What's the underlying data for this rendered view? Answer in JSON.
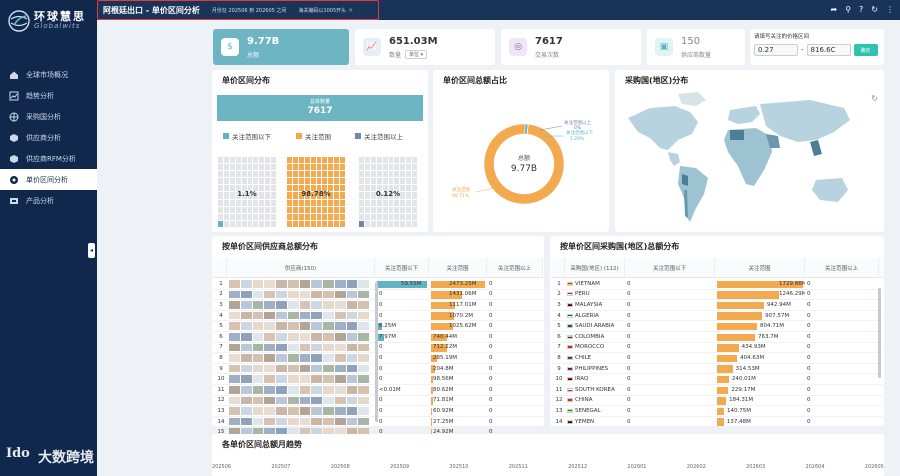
{
  "sidebar": {
    "logo_cn": "环球慧思",
    "logo_en": "Globalwits",
    "items": [
      {
        "label": "全球市场概况",
        "icon": "home-icon",
        "active": false
      },
      {
        "label": "趋势分析",
        "icon": "trend-icon",
        "active": false
      },
      {
        "label": "采购国分析",
        "icon": "globe-icon",
        "active": false
      },
      {
        "label": "供应商分析",
        "icon": "box-icon",
        "active": false
      },
      {
        "label": "供应商RFM分析",
        "icon": "box-icon",
        "active": false
      },
      {
        "label": "单价区间分析",
        "icon": "price-icon",
        "active": true
      },
      {
        "label": "产品分析",
        "icon": "product-icon",
        "active": false
      }
    ]
  },
  "watermark": {
    "mark": "Ido",
    "text": "大数跨境"
  },
  "topbar": {
    "tab_main": "阿根廷出口 - 单价区间分析",
    "tab_period": "月份在 202506 到 202605 之间",
    "tab_hs": "海关编码以1005开头",
    "close": "×"
  },
  "kpis": [
    {
      "value": "9.77B",
      "label": "总额",
      "icon": "dollar-icon"
    },
    {
      "value": "651.03M",
      "label": "数量",
      "unit": "单位",
      "icon": "chart-icon"
    },
    {
      "value": "7617",
      "label": "交易次数",
      "icon": "target-icon"
    },
    {
      "value": "150",
      "label": "供应商数量",
      "icon": "cube-icon"
    }
  ],
  "range": {
    "title": "请填写关注的价格区间",
    "min": "0.27",
    "sep": "-",
    "max": "816.6C",
    "button": "确定"
  },
  "dist": {
    "title": "单价区间分布",
    "total_label": "总体数量",
    "total_value": "7617",
    "legend": [
      "关注范围以下",
      "关注范围",
      "关注范围以上"
    ],
    "percents": [
      "1.1%",
      "98.78%",
      "0.12%"
    ],
    "fractions": [
      0.011,
      0.9878,
      0.0012
    ],
    "colors": [
      "#5fb3c4",
      "#f3aa4e",
      "#6f86a8"
    ]
  },
  "share": {
    "title": "单价区间总额占比",
    "center_label": "总额",
    "center_value": "9.77B",
    "slices": [
      {
        "label": "关注范围以上",
        "pct": "0%",
        "value": 0.0,
        "color": "#6f86a8"
      },
      {
        "label": "关注范围以下",
        "pct": "1.29%",
        "value": 1.29,
        "color": "#5fb3c4"
      },
      {
        "label": "关注范围",
        "pct": "98.71%",
        "value": 98.71,
        "color": "#f3aa4e"
      }
    ]
  },
  "map": {
    "title": "采购国(地区)分布"
  },
  "supplier_table": {
    "title": "按单价区间供应商总额分布",
    "headers": [
      "供应商(150)",
      "关注范围以下",
      "关注范围",
      "关注范围以上"
    ],
    "max_mid": 2473.25,
    "max_below": 59.55,
    "rows": [
      {
        "n": "1",
        "below": "59.55M",
        "below_v": 59.55,
        "mid": "2473.25M",
        "mid_v": 2473.25,
        "above": "0"
      },
      {
        "n": "2",
        "below": "0",
        "below_v": 0,
        "mid": "1431.06M",
        "mid_v": 1431.06,
        "above": "0"
      },
      {
        "n": "3",
        "below": "0",
        "below_v": 0,
        "mid": "1117.01M",
        "mid_v": 1117.01,
        "above": "0"
      },
      {
        "n": "4",
        "below": "0",
        "below_v": 0,
        "mid": "1070.2M",
        "mid_v": 1070.2,
        "above": "0"
      },
      {
        "n": "5",
        "below": "6.25M",
        "below_v": 6.25,
        "mid": "1025.62M",
        "mid_v": 1025.62,
        "above": "0"
      },
      {
        "n": "6",
        "below": "7.97M",
        "below_v": 7.97,
        "mid": "740.44M",
        "mid_v": 740.44,
        "above": "0"
      },
      {
        "n": "7",
        "below": "0",
        "below_v": 0,
        "mid": "712.22M",
        "mid_v": 712.22,
        "above": "0"
      },
      {
        "n": "8",
        "below": "0",
        "below_v": 0,
        "mid": "285.19M",
        "mid_v": 285.19,
        "above": "0"
      },
      {
        "n": "9",
        "below": "0",
        "below_v": 0,
        "mid": "204.8M",
        "mid_v": 204.8,
        "above": "0"
      },
      {
        "n": "10",
        "below": "0",
        "below_v": 0,
        "mid": "98.56M",
        "mid_v": 98.56,
        "above": "0"
      },
      {
        "n": "11",
        "below": "<0.01M",
        "below_v": 0,
        "mid": "80.62M",
        "mid_v": 80.62,
        "above": "0"
      },
      {
        "n": "12",
        "below": "0",
        "below_v": 0,
        "mid": "71.81M",
        "mid_v": 71.81,
        "above": "0"
      },
      {
        "n": "13",
        "below": "0",
        "below_v": 0,
        "mid": "60.92M",
        "mid_v": 60.92,
        "above": "0"
      },
      {
        "n": "14",
        "below": "0",
        "below_v": 0,
        "mid": "27.25M",
        "mid_v": 27.25,
        "above": "0"
      },
      {
        "n": "15",
        "below": "0",
        "below_v": 0,
        "mid": "24.92M",
        "mid_v": 24.92,
        "above": "0"
      }
    ]
  },
  "country_table": {
    "title": "按单价区间采购国(地区)总额分布",
    "headers": [
      "采购国(地区) (112)",
      "关注范围以下",
      "关注范围",
      "关注范围以上"
    ],
    "max_mid": 1729.86,
    "rows": [
      {
        "n": "1",
        "name": "VIETNAM",
        "below": "0",
        "mid": "1729.86M",
        "mid_v": 1729.86,
        "above": "0",
        "flag": [
          "#da251d",
          "#ffde00"
        ]
      },
      {
        "n": "2",
        "name": "PERU",
        "below": "0",
        "mid": "1246.29M",
        "mid_v": 1246.29,
        "above": "0",
        "flag": [
          "#d91023",
          "#ffffff"
        ]
      },
      {
        "n": "3",
        "name": "MALAYSIA",
        "below": "0",
        "mid": "942.94M",
        "mid_v": 942.94,
        "above": "0",
        "flag": [
          "#cc0001",
          "#010066"
        ]
      },
      {
        "n": "4",
        "name": "ALGERIA",
        "below": "0",
        "mid": "907.57M",
        "mid_v": 907.57,
        "above": "0",
        "flag": [
          "#006233",
          "#ffffff"
        ]
      },
      {
        "n": "5",
        "name": "SAUDI ARABIA",
        "below": "0",
        "mid": "804.71M",
        "mid_v": 804.71,
        "above": "0",
        "flag": [
          "#006c35",
          "#006c35"
        ]
      },
      {
        "n": "6",
        "name": "COLOMBIA",
        "below": "0",
        "mid": "763.7M",
        "mid_v": 763.7,
        "above": "0",
        "flag": [
          "#fcd116",
          "#003893"
        ]
      },
      {
        "n": "7",
        "name": "MOROCCO",
        "below": "0",
        "mid": "434.93M",
        "mid_v": 434.93,
        "above": "0",
        "flag": [
          "#c1272d",
          "#c1272d"
        ]
      },
      {
        "n": "8",
        "name": "CHILE",
        "below": "0",
        "mid": "404.63M",
        "mid_v": 404.63,
        "above": "0",
        "flag": [
          "#0039a6",
          "#d52b1e"
        ]
      },
      {
        "n": "9",
        "name": "PHILIPPINES",
        "below": "0",
        "mid": "314.53M",
        "mid_v": 314.53,
        "above": "0",
        "flag": [
          "#0038a8",
          "#ce1126"
        ]
      },
      {
        "n": "10",
        "name": "IRAQ",
        "below": "0",
        "mid": "240.01M",
        "mid_v": 240.01,
        "above": "0",
        "flag": [
          "#ce1126",
          "#000000"
        ]
      },
      {
        "n": "11",
        "name": "SOUTH KOREA",
        "below": "0",
        "mid": "229.17M",
        "mid_v": 229.17,
        "above": "0",
        "flag": [
          "#ffffff",
          "#cd2e3a"
        ]
      },
      {
        "n": "12",
        "name": "CHINA",
        "below": "0",
        "mid": "184.31M",
        "mid_v": 184.31,
        "above": "0",
        "flag": [
          "#de2910",
          "#de2910"
        ]
      },
      {
        "n": "13",
        "name": "SENEGAL",
        "below": "0",
        "mid": "140.75M",
        "mid_v": 140.75,
        "above": "0",
        "flag": [
          "#00853f",
          "#fdef42"
        ]
      },
      {
        "n": "14",
        "name": "YEMEN",
        "below": "0",
        "mid": "137.48M",
        "mid_v": 137.48,
        "above": "0",
        "flag": [
          "#ce1126",
          "#000000"
        ]
      }
    ]
  },
  "trend": {
    "title": "各单价区间总额月趋势",
    "months": [
      "202506",
      "202507",
      "202508",
      "202509",
      "202510",
      "202511",
      "202512",
      "202601",
      "202602",
      "202603",
      "202604",
      "202605"
    ]
  }
}
